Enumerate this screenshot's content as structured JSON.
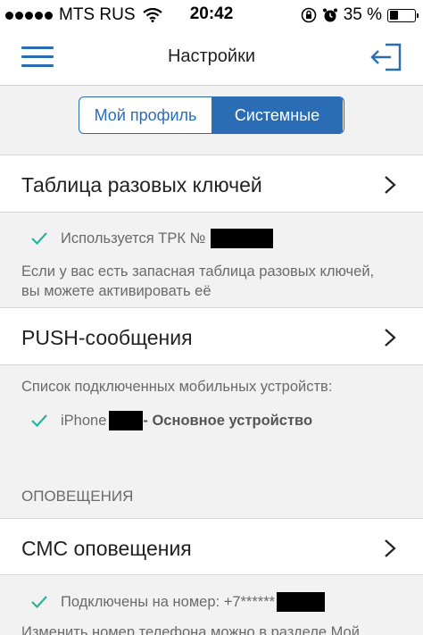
{
  "status_bar": {
    "carrier": "MTS RUS",
    "time": "20:42",
    "battery_percent_label": "35 %",
    "battery_level": 0.35
  },
  "nav": {
    "title": "Настройки",
    "menu_icon": "hamburger-menu-icon",
    "exit_icon": "logout-icon"
  },
  "segment": {
    "options": [
      "Мой профиль",
      "Системные"
    ],
    "selected": "Системные"
  },
  "otp_keys": {
    "label": "Таблица разовых ключей",
    "status": "Используется ТРК №",
    "hint_line1": "Если у вас есть запасная таблица разовых ключей,",
    "hint_line2": "вы можете активировать её"
  },
  "push": {
    "label": "PUSH-сообщения",
    "devices_caption": "Список подключенных мобильных устройств:",
    "device_name": "iPhone",
    "device_suffix": "- Основное устройство"
  },
  "notifications": {
    "section_header": "ОПОВЕЩЕНИЯ",
    "sms_label": "СМС оповещения",
    "connected_prefix": "Подключены на номер: +7******",
    "hint": "Изменить номер телефона можно в разделе Мой"
  },
  "colors": {
    "accent": "#2a6db5",
    "check": "#2bb39a"
  }
}
